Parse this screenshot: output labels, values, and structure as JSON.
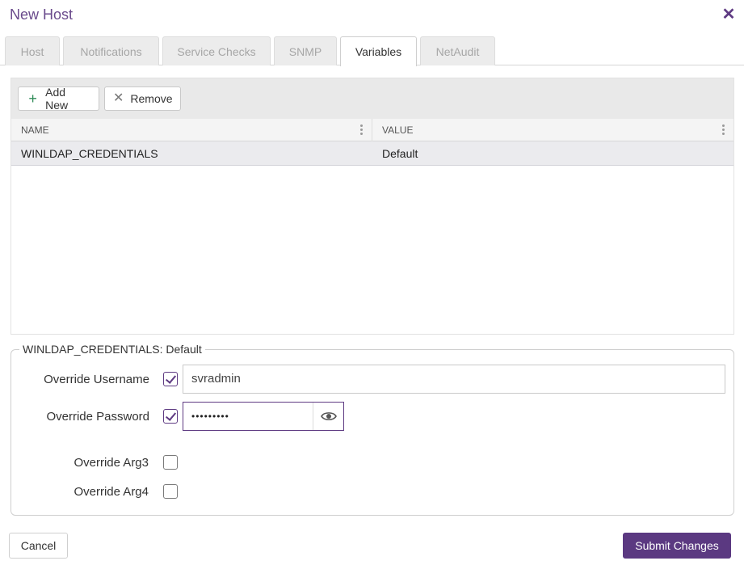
{
  "window": {
    "title": "New Host",
    "close_icon": "close-icon"
  },
  "tabs": [
    {
      "label": "Host",
      "active": false
    },
    {
      "label": "Notifications",
      "active": false
    },
    {
      "label": "Service Checks",
      "active": false
    },
    {
      "label": "SNMP",
      "active": false
    },
    {
      "label": "Variables",
      "active": true
    },
    {
      "label": "NetAudit",
      "active": false
    }
  ],
  "toolbar": {
    "add_label": "Add New",
    "remove_label": "Remove"
  },
  "table": {
    "columns": [
      "NAME",
      "VALUE"
    ],
    "rows": [
      {
        "name": "WINLDAP_CREDENTIALS",
        "value": "Default"
      }
    ]
  },
  "detail": {
    "legend": "WINLDAP_CREDENTIALS: Default",
    "username_label": "Override Username",
    "username_checked": true,
    "username_value": "svradmin",
    "password_label": "Override Password",
    "password_checked": true,
    "password_value": "•••••••••",
    "arg3_label": "Override Arg3",
    "arg3_checked": false,
    "arg4_label": "Override Arg4",
    "arg4_checked": false
  },
  "footer": {
    "cancel_label": "Cancel",
    "submit_label": "Submit Changes"
  },
  "colors": {
    "accent": "#5b3981",
    "title": "#6a4a8c",
    "add_icon": "#2e8b57"
  }
}
